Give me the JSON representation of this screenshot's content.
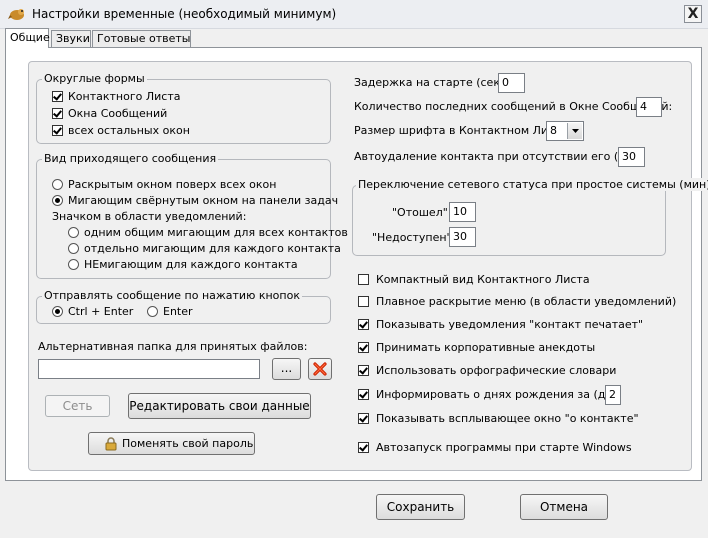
{
  "window": {
    "title": "Настройки временные (необходимый минимум)",
    "close_glyph": "X"
  },
  "tabs": [
    "Общие",
    "Звуки",
    "Готовые ответы"
  ],
  "round_forms": {
    "legend": "Округлые формы",
    "items": [
      {
        "label": "Контактного Листа",
        "checked": true
      },
      {
        "label": "Окна Сообщений",
        "checked": true
      },
      {
        "label": "всех остальных окон",
        "checked": true
      }
    ]
  },
  "incoming": {
    "legend": "Вид приходящего сообщения",
    "options": [
      {
        "label": "Раскрытым окном поверх всех окон",
        "checked": false
      },
      {
        "label": "Мигающим свёрнутым окном на панели задач",
        "checked": true
      }
    ],
    "tray_label": "Значком в области уведомлений:",
    "tray_options": [
      {
        "label": "одним общим мигающим для всех контактов",
        "checked": false
      },
      {
        "label": "отдельно мигающим для каждого контакта",
        "checked": false
      },
      {
        "label": "НЕмигающим для каждого контакта",
        "checked": false
      }
    ]
  },
  "send": {
    "legend": "Отправлять сообщение по нажатию кнопок",
    "options": [
      {
        "label": "Ctrl + Enter",
        "checked": true
      },
      {
        "label": "Enter",
        "checked": false
      }
    ]
  },
  "files": {
    "label": "Альтернативная папка для принятых файлов:",
    "value": "",
    "browse": "...",
    "clear_icon": "red-x-icon"
  },
  "buttons": {
    "network": "Сеть",
    "edit_data": "Редактировать свои данные",
    "change_password": "Поменять свой пароль",
    "save": "Сохранить",
    "cancel": "Отмена"
  },
  "settings": {
    "startup_delay": {
      "label": "Задержка на старте (сек.):",
      "value": "0"
    },
    "last_messages": {
      "label": "Количество последних сообщений в Окне Сообщений:",
      "value": "4"
    },
    "font_size": {
      "label": "Размер шрифта в Контактном Листе:",
      "value": "8"
    },
    "auto_delete": {
      "label": "Автоудаление контакта при отсутствии его (дн.):",
      "value": "30"
    }
  },
  "idle": {
    "legend": "Переключение сетевого статуса при простое системы (мин)",
    "away": {
      "label": "\"Отошел\"",
      "value": "10"
    },
    "na": {
      "label": "\"Недоступен\"",
      "value": "30"
    }
  },
  "checkboxes": [
    {
      "label": "Компактный вид Контактного Листа",
      "checked": false
    },
    {
      "label": "Плавное раскрытие меню (в области уведомлений)",
      "checked": false
    },
    {
      "label": "Показывать уведомления \"контакт печатает\"",
      "checked": true
    },
    {
      "label": "Принимать корпоративные анекдоты",
      "checked": true
    },
    {
      "label": "Использовать орфографические словари",
      "checked": true
    },
    {
      "label": "Информировать о днях рождения за (дн.)",
      "checked": true
    },
    {
      "label": "Показывать всплывающее окно \"о контакте\"",
      "checked": true
    },
    {
      "label": "Автозапуск программы при старте Windows",
      "checked": true
    }
  ],
  "birthday_days": "2",
  "colors": {
    "accent": "#cc2200",
    "lock": "#d9a93a"
  }
}
